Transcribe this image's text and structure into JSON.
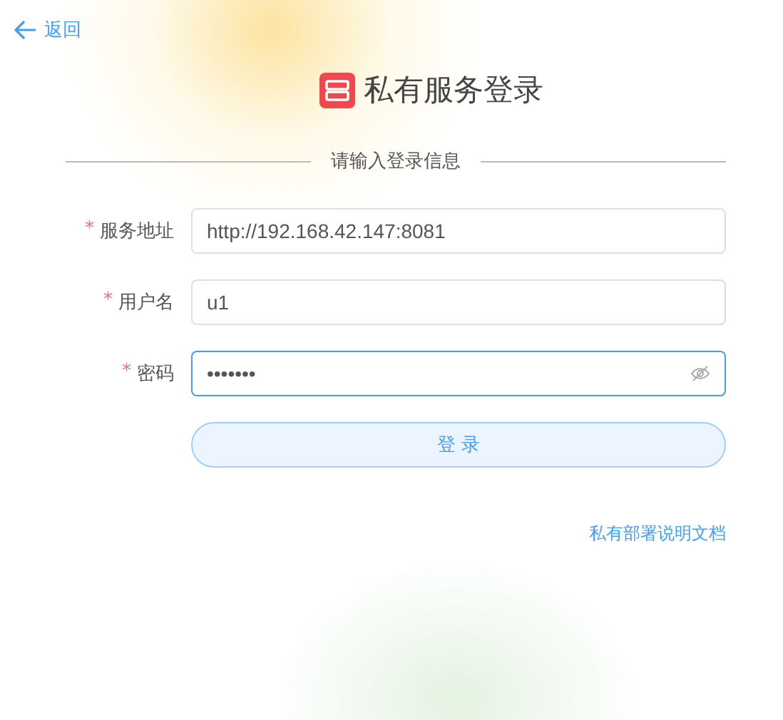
{
  "back": {
    "label": "返回"
  },
  "title": "私有服务登录",
  "divider_text": "请输入登录信息",
  "fields": [
    {
      "kind": "text",
      "required_mark": "*",
      "label": "服务地址",
      "value": "http://192.168.42.147:8081",
      "focused": false
    },
    {
      "kind": "text",
      "required_mark": "*",
      "label": "用户名",
      "value": "u1",
      "focused": false
    },
    {
      "kind": "password",
      "required_mark": "*",
      "label": "密码",
      "value": "•••••••",
      "focused": true
    }
  ],
  "submit": {
    "label": "登 录"
  },
  "doc_link": "私有部署说明文档"
}
